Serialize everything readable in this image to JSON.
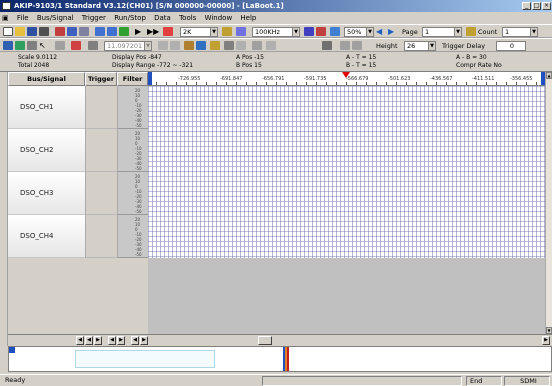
{
  "window": {
    "title": "AKIP-9103/1 Standard V3.12(CH01) [S/N 000000-00000] - [LaBoot.1]",
    "controls": [
      "_",
      "□",
      "×"
    ]
  },
  "menu": [
    "File",
    "Bus/Signal",
    "Trigger",
    "Run/Stop",
    "Data",
    "Tools",
    "Window",
    "Help"
  ],
  "toolbar1": {
    "depth_value": "2K",
    "rate_value": "100KHz",
    "zoom_value": "50%",
    "page_label": "Page",
    "page_value": "1",
    "count_label": "Count",
    "count_value": "1"
  },
  "toolbar2": {
    "position_value": "11.097201",
    "height_label": "Height",
    "height_value": "26",
    "trigger_delay_label": "Trigger Delay",
    "trigger_delay_value": "0"
  },
  "info": {
    "scale": "Scale 9.0112",
    "total": "Total 2048",
    "display_pos": "Display Pos -847",
    "display_range": "Display Range -772 ~ -321",
    "a_pos": "A Pos -15",
    "b_pos": "B Pos 15",
    "a_t": "A - T = 15",
    "b_t": "B - T = 15",
    "a_b": "A - B = 30",
    "compr_rate": "Compr Rate No"
  },
  "columns": {
    "signal": "Bus/Signal",
    "trigger": "Trigger",
    "filter": "Filter"
  },
  "signals": [
    {
      "name": "DSO_CH1"
    },
    {
      "name": "DSO_CH2"
    },
    {
      "name": "DSO_CH3"
    },
    {
      "name": "DSO_CH4"
    }
  ],
  "ruler_labels": [
    "-726.955",
    "-691.847",
    "-656.791",
    "-591.735",
    "-566.679",
    "-501.623",
    "-436.567",
    "-411.511",
    "-356.455"
  ],
  "status": {
    "left": "Ready",
    "mid": "End",
    "right": "SDMI"
  },
  "colors": {
    "title_start": "#0a246a",
    "title_end": "#a6caf0",
    "trigger_marker": "#e00000",
    "grid": "#8a8ac8"
  }
}
